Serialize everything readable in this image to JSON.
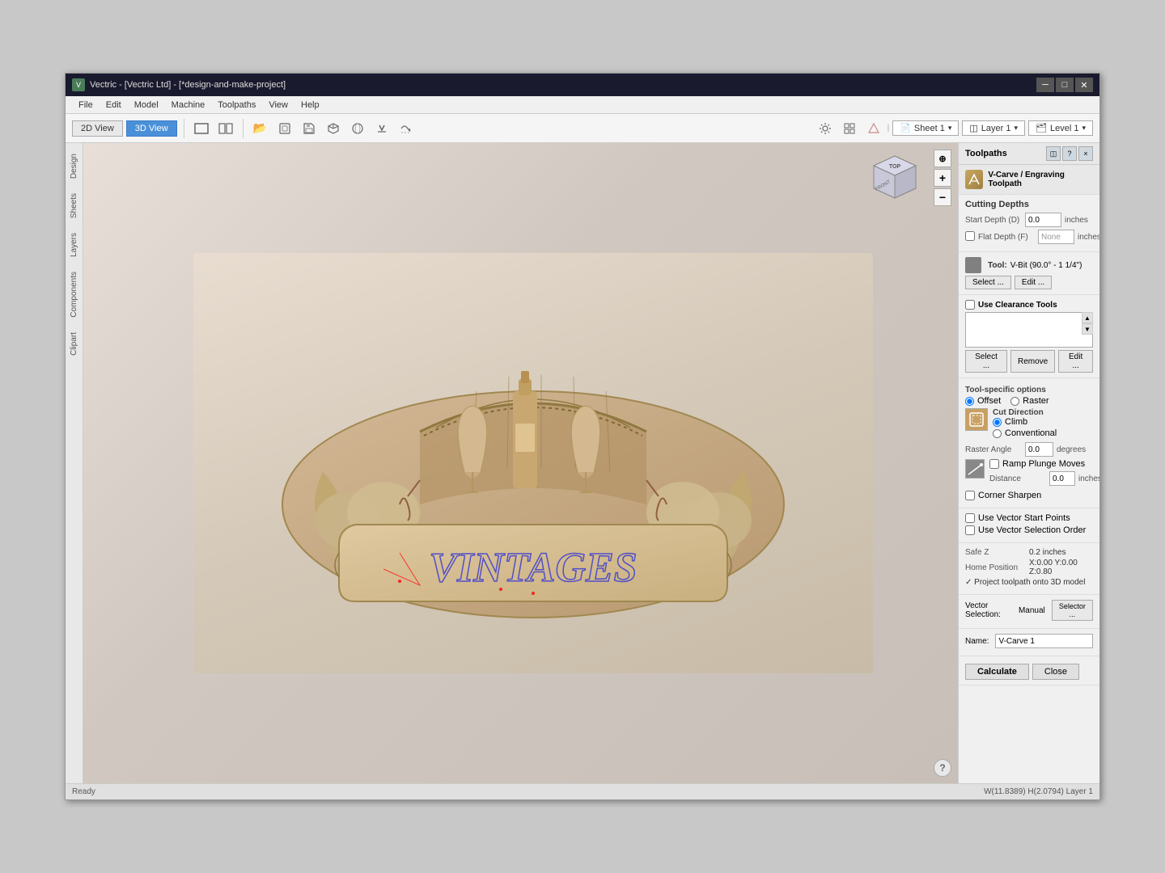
{
  "window": {
    "title": "Vectric - [Vectric Ltd] - [*design-and-make-project]",
    "icon": "V"
  },
  "titlebar": {
    "minimize": "─",
    "maximize": "□",
    "close": "✕"
  },
  "menubar": {
    "items": [
      "File",
      "Edit",
      "Model",
      "Machine",
      "Toolpaths",
      "View",
      "Help"
    ]
  },
  "toolbar": {
    "view_2d": "2D View",
    "view_3d": "3D View",
    "sheet_label": "Sheet 1",
    "layer_label": "Layer 1",
    "level_label": "Level 1"
  },
  "sidebar_tabs": [
    "Design",
    "Sheets",
    "Layers",
    "Components",
    "Clipart"
  ],
  "viewport": {
    "cube_labels": {
      "top": "TOP",
      "front": "FRONT"
    }
  },
  "right_panel": {
    "header": "Toolpaths",
    "toolpath_name_label": "V-Carve / Engraving Toolpath",
    "sections": {
      "cutting_depths": {
        "title": "Cutting Depths",
        "start_depth_label": "Start Depth (D)",
        "start_depth_value": "0.0",
        "start_depth_unit": "inches",
        "flat_depth_label": "Flat Depth (F)",
        "flat_depth_value": "None",
        "flat_depth_unit": "inches"
      },
      "tool": {
        "title": "Tool",
        "tool_name": "V-Bit (90.0° - 1 1/4\")",
        "select_btn": "Select ...",
        "edit_btn": "Edit ..."
      },
      "clearance_tools": {
        "title": "Use Clearance Tools",
        "select_btn": "Select ...",
        "remove_btn": "Remove",
        "edit_btn": "Edit ..."
      },
      "tool_options": {
        "title": "Tool-specific options",
        "offset_label": "Offset",
        "raster_label": "Raster",
        "cut_direction_label": "Cut Direction",
        "climb_label": "Climb",
        "conventional_label": "Conventional",
        "raster_angle_label": "Raster Angle",
        "raster_angle_value": "0.0",
        "raster_angle_unit": "degrees",
        "ramp_plunge_label": "Ramp Plunge Moves",
        "distance_label": "Distance",
        "distance_value": "0.0",
        "distance_unit": "inches",
        "corner_sharpen_label": "Corner Sharpen"
      },
      "vector_settings": {
        "use_start_points_label": "Use Vector Start Points",
        "use_selection_order_label": "Use Vector Selection Order"
      },
      "machine_vectors": {
        "safe_z_label": "Safe Z",
        "safe_z_value": "0.2 inches",
        "home_position_label": "Home Position",
        "home_position_value": "X:0.00 Y:0.00 Z:0.80",
        "project_label": "✓ Project toolpath onto 3D model"
      },
      "vector_selection": {
        "label": "Vector Selection:",
        "value": "Manual",
        "selector_btn": "Selector ..."
      },
      "name": {
        "label": "Name:",
        "value": "V-Carve 1"
      },
      "buttons": {
        "calculate": "Calculate",
        "close": "Close"
      }
    }
  },
  "status_bar": {
    "ready": "Ready",
    "info": "W(11.8389) H(2.0794) Layer 1"
  }
}
